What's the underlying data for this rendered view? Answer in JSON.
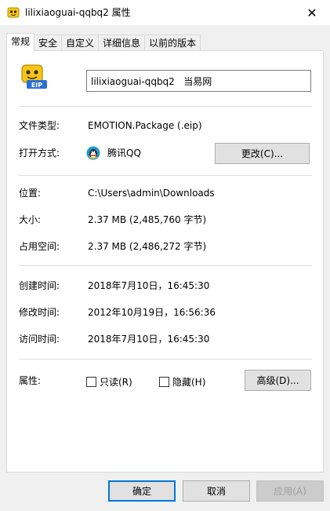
{
  "window": {
    "title": "lilixiaoguai-qqbq2 属性",
    "close_label": "✕"
  },
  "tabs": [
    {
      "label": "常规"
    },
    {
      "label": "安全"
    },
    {
      "label": "自定义"
    },
    {
      "label": "详细信息"
    },
    {
      "label": "以前的版本"
    }
  ],
  "general": {
    "file_name": "lilixiaoguai-qqbq2   当易网",
    "file_icon_text": "EIP",
    "type_label": "文件类型:",
    "type_value": "EMOTION.Package (.eip)",
    "open_with_label": "打开方式:",
    "open_with_value": "腾讯QQ",
    "change_button": "更改(C)...",
    "location_label": "位置:",
    "location_value": "C:\\Users\\admin\\Downloads",
    "size_label": "大小:",
    "size_value": "2.37 MB (2,485,760 字节)",
    "disk_size_label": "占用空间:",
    "disk_size_value": "2.37 MB (2,486,272 字节)",
    "created_label": "创建时间:",
    "created_value": "2018年7月10日，16:45:30",
    "modified_label": "修改时间:",
    "modified_value": "2012年10月19日，16:56:36",
    "accessed_label": "访问时间:",
    "accessed_value": "2018年7月10日，16:45:30",
    "attributes_label": "属性:",
    "readonly_label": "只读(R)",
    "hidden_label": "隐藏(H)",
    "advanced_button": "高级(D)..."
  },
  "footer": {
    "ok_button": "确定",
    "cancel_button": "取消",
    "apply_button": "应用(A)"
  },
  "colors": {
    "accent": "#0078d7",
    "icon_yellow": "#f5c518",
    "icon_blue": "#2a6fd6"
  }
}
